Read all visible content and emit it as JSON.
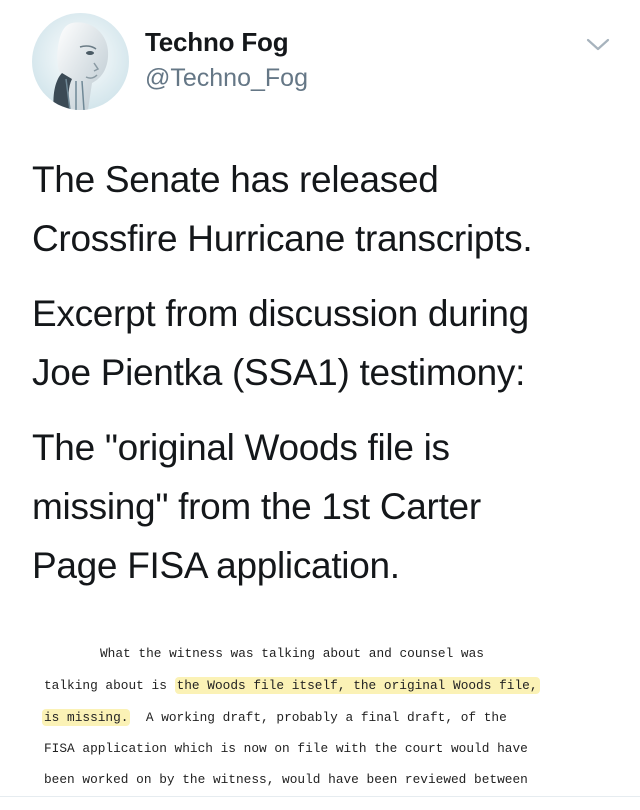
{
  "tweet": {
    "author": {
      "name": "Techno Fog",
      "handle": "@Techno_Fog",
      "avatar_icon": "robot-avatar-icon"
    },
    "menu_icon": "chevron-down-icon",
    "paragraphs": [
      [
        "The Senate has released",
        "Crossfire Hurricane transcripts."
      ],
      [
        "Excerpt from discussion during",
        "Joe Pientka (SSA1) testimony:"
      ],
      [
        "The \"original Woods file is",
        "missing\" from the 1st Carter",
        "Page FISA application."
      ]
    ]
  },
  "document_excerpt": {
    "line1": "What the witness was talking about and counsel was",
    "line2_plain": "talking about is ",
    "line2_highlight": "the Woods file itself, the original Woods file,",
    "line3_highlight": "is missing.",
    "line3_plain": "  A working draft, probably a final draft, of the",
    "line4": "FISA application which is now on file with the court would have",
    "line5": "been worked on by the witness, would have been reviewed between",
    "highlight_color": "#fbf2b6"
  }
}
